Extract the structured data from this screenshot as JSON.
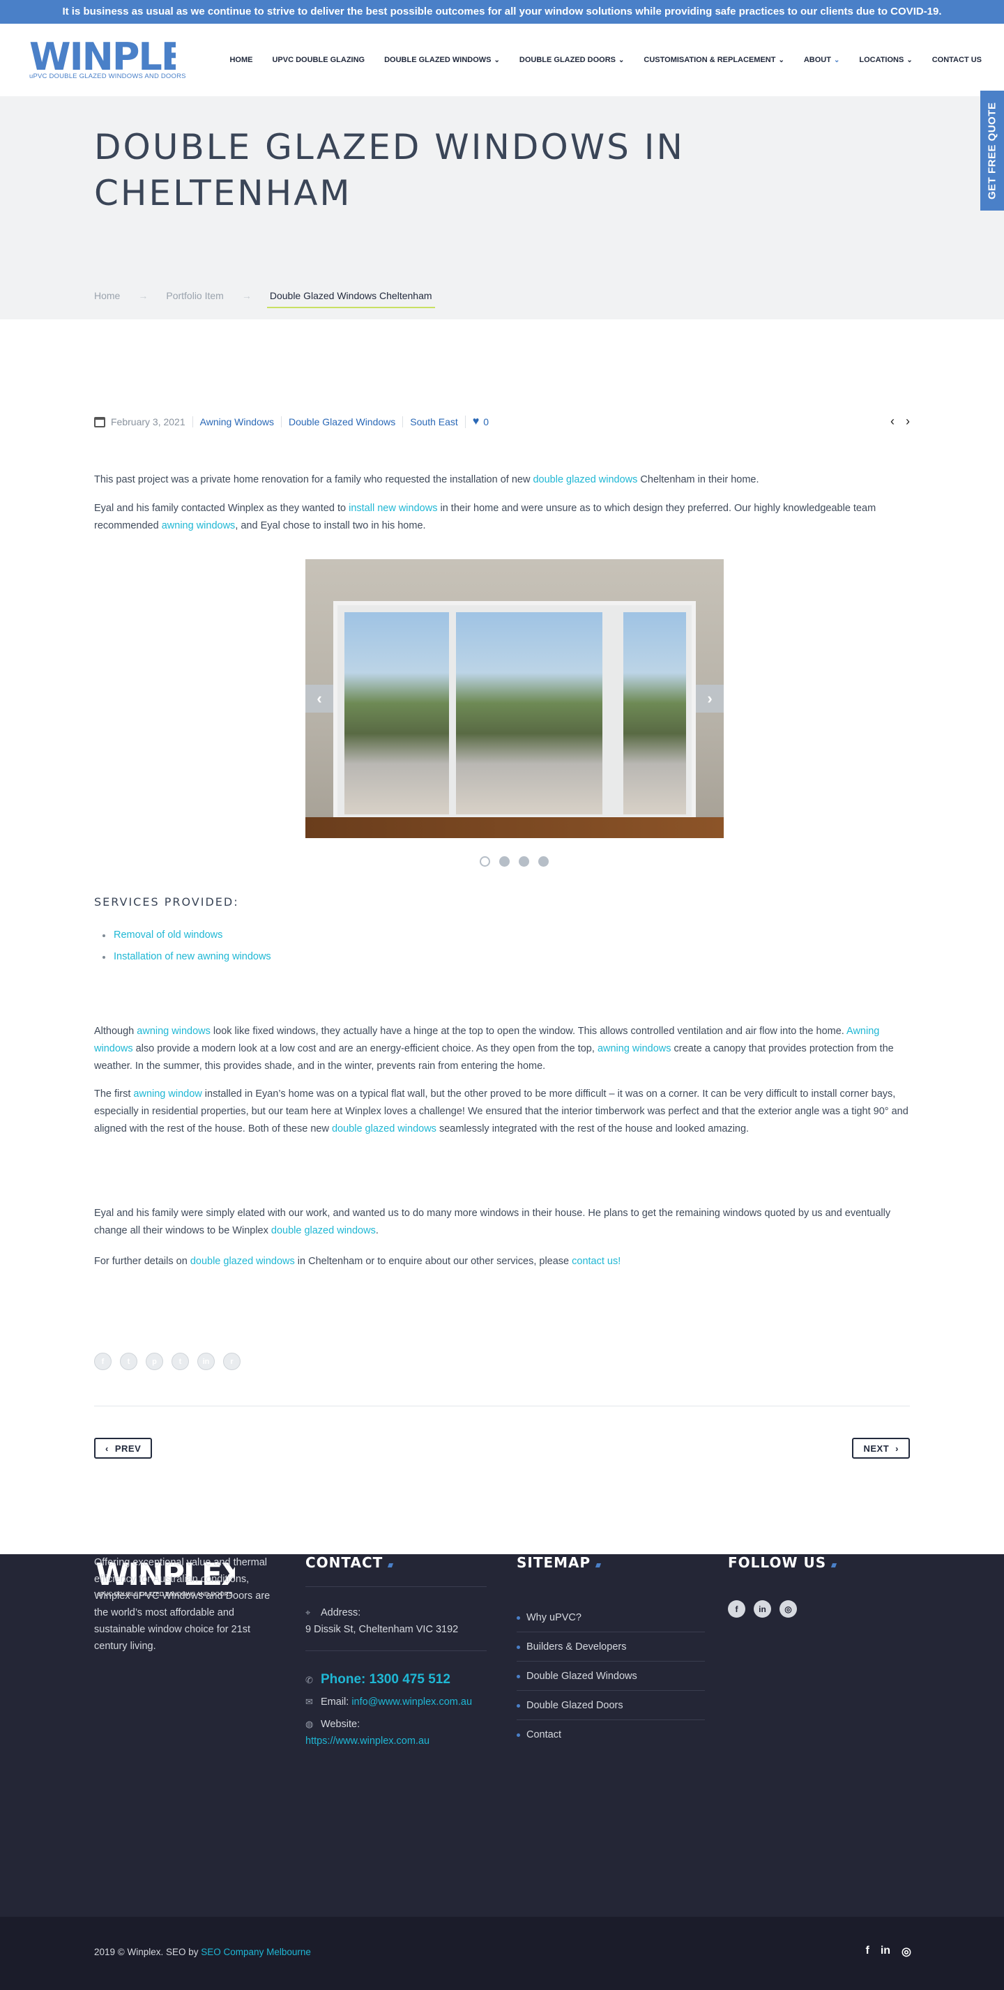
{
  "topbar": {
    "text": "It is business as usual as we continue to strive to deliver the best possible outcomes for all your window solutions while providing safe practices to our clients due to COVID-19."
  },
  "logo": {
    "word": "WINPLEX",
    "tagline": "uPVC DOUBLE GLAZED WINDOWS AND DOORS"
  },
  "nav": {
    "items": [
      {
        "label": "HOME",
        "dropdown": false
      },
      {
        "label": "UPVC DOUBLE GLAZING",
        "dropdown": false
      },
      {
        "label": "DOUBLE GLAZED WINDOWS",
        "dropdown": true
      },
      {
        "label": "DOUBLE GLAZED DOORS",
        "dropdown": true
      },
      {
        "label": "CUSTOMISATION & REPLACEMENT",
        "dropdown": true
      },
      {
        "label": "ABOUT",
        "dropdown": true
      },
      {
        "label": "LOCATIONS",
        "dropdown": true
      },
      {
        "label": "CONTACT US",
        "dropdown": false
      }
    ]
  },
  "quote_tab": {
    "label": "GET FREE QUOTE"
  },
  "hero": {
    "title": "DOUBLE GLAZED WINDOWS IN CHELTENHAM",
    "breadcrumb": [
      "Home",
      "Portfolio Item",
      "Double Glazed Windows Cheltenham"
    ],
    "breadcrumb_sep": "→"
  },
  "meta": {
    "date": "February 3, 2021",
    "tags": [
      "Awning Windows",
      "Double Glazed Windows",
      "South East"
    ],
    "likes": "0"
  },
  "article": {
    "p1": [
      "This past project was a private home renovation for a family who requested the installation of new ",
      "double glazed windows",
      " Cheltenham in their home."
    ],
    "p2": [
      "Eyal and his family contacted Winplex as they wanted to ",
      "install new windows",
      " in their home and were unsure as to which design they preferred. Our highly knowledgeable team recommended ",
      "awning windows",
      ", and Eyal chose to install two in his home."
    ],
    "services_title": "SERVICES PROVIDED:",
    "services": [
      "Removal of old windows",
      "Installation of new awning windows"
    ],
    "p3": [
      "Although ",
      "awning windows",
      " look like fixed windows, they actually have a hinge at the top to open the window. This allows controlled ventilation and air flow into the home. ",
      "Awning windows",
      " also provide a modern look at a low cost and are an energy-efficient choice. As they open from the top, ",
      "awning windows",
      " create a canopy that provides protection from the weather. In the summer, this provides shade, and in the winter, prevents rain from entering the home."
    ],
    "p4": [
      "The first ",
      "awning window",
      " installed in Eyan’s home was on a typical flat wall, but the other proved to be more difficult – it was on a corner. It can be very difficult to install corner bays, especially in residential properties, but our team here at Winplex loves a challenge! We ensured that the interior timberwork was perfect and that the exterior angle was a tight 90° and aligned with the rest of the house. Both of these new ",
      "double glazed windows",
      " seamlessly integrated with the rest of the house and looked amazing."
    ],
    "p5": [
      "Eyal and his family were simply elated with our work, and wanted us to do many more windows in their house. He plans to get the remaining windows quoted by us and eventually change all their windows to be Winplex ",
      "double glazed windows",
      "."
    ],
    "p6": [
      "For further details on ",
      "double glazed windows",
      " in Cheltenham or to enquire about our other services, please ",
      "contact us!",
      ""
    ]
  },
  "slider": {
    "slide_count": 4,
    "active_slide": 1,
    "prev_icon": "chevron-left-icon",
    "next_icon": "chevron-right-icon"
  },
  "share": {
    "icons": [
      "facebook-icon",
      "twitter-icon",
      "pinterest-icon",
      "tumblr-icon",
      "linkedin-icon",
      "reddit-icon"
    ],
    "glyphs": [
      "f",
      "t",
      "p",
      "t",
      "in",
      "r"
    ]
  },
  "pager": {
    "prev": "PREV",
    "next": "NEXT"
  },
  "footer": {
    "logo_word": "WINPLEX",
    "logo_tagline": "uPVC DOUBLE GLAZED WINDOWS AND DOORS",
    "about": "Offering exceptional value and thermal efficiency for Australian conditions, Winplex uPVC Windows and Doors are the world’s most affordable and sustainable window choice for 21st century living.",
    "contact": {
      "title": "CONTACT",
      "address_label": "Address:",
      "address": "9 Dissik St, Cheltenham VIC 3192",
      "phone": "Phone: 1300 475 512",
      "email_label": "Email:",
      "email": "info@www.winplex.com.au",
      "website_label": "Website:",
      "website": "https://www.winplex.com.au"
    },
    "sitemap": {
      "title": "SITEMAP",
      "items": [
        "Why uPVC?",
        "Builders & Developers",
        "Double Glazed Windows",
        "Double Glazed Doors",
        "Contact"
      ]
    },
    "follow": {
      "title": "FOLLOW US",
      "icons": [
        "facebook-icon",
        "linkedin-icon",
        "instagram-icon"
      ],
      "glyphs": [
        "f",
        "in",
        "◎"
      ]
    }
  },
  "bottom": {
    "copy_prefix": "2019 © Winplex. SEO by ",
    "copy_link": "SEO Company Melbourne",
    "icons": [
      "facebook-icon",
      "linkedin-icon",
      "instagram-icon"
    ],
    "glyphs": [
      "f",
      "in",
      "◎"
    ]
  },
  "colors": {
    "brand": "#4a80c8",
    "link": "#1fb7d4",
    "dark": "#242636",
    "accent_underline": "#c9e063"
  }
}
